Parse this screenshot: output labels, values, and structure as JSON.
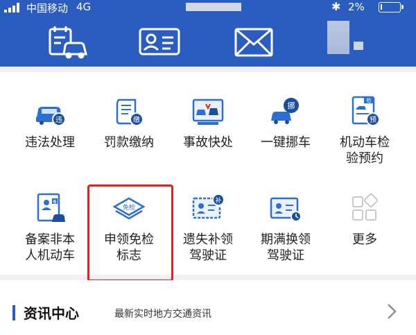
{
  "status_bar": {
    "carrier": "中国移动",
    "network": "4G",
    "battery": "2%"
  },
  "header_icons": [
    {
      "name": "vehicle-record-icon"
    },
    {
      "name": "id-card-icon"
    },
    {
      "name": "mail-icon"
    }
  ],
  "services": [
    {
      "label": "违法处理",
      "badge": "违"
    },
    {
      "label": "罚款缴纳",
      "badge": "缴"
    },
    {
      "label": "事故快处"
    },
    {
      "label": "一键挪车",
      "badge": "挪"
    },
    {
      "label": "机动车检\n验预约",
      "badge": "检",
      "badge2": "预"
    },
    {
      "label": "备案非本\n人机动车",
      "badge": "备"
    },
    {
      "label": "申领免检\n标志",
      "badge": "免检"
    },
    {
      "label": "遗失补领\n驾驶证",
      "badge": "补"
    },
    {
      "label": "期满换领\n驾驶证"
    },
    {
      "label": "更多"
    }
  ],
  "news": {
    "title": "资讯中心",
    "subtitle": "最新实时地方交通资讯"
  },
  "colors": {
    "header_bg": "#2b5cbf",
    "icon_blue": "#2b6fd6",
    "highlight": "#e0211f"
  }
}
